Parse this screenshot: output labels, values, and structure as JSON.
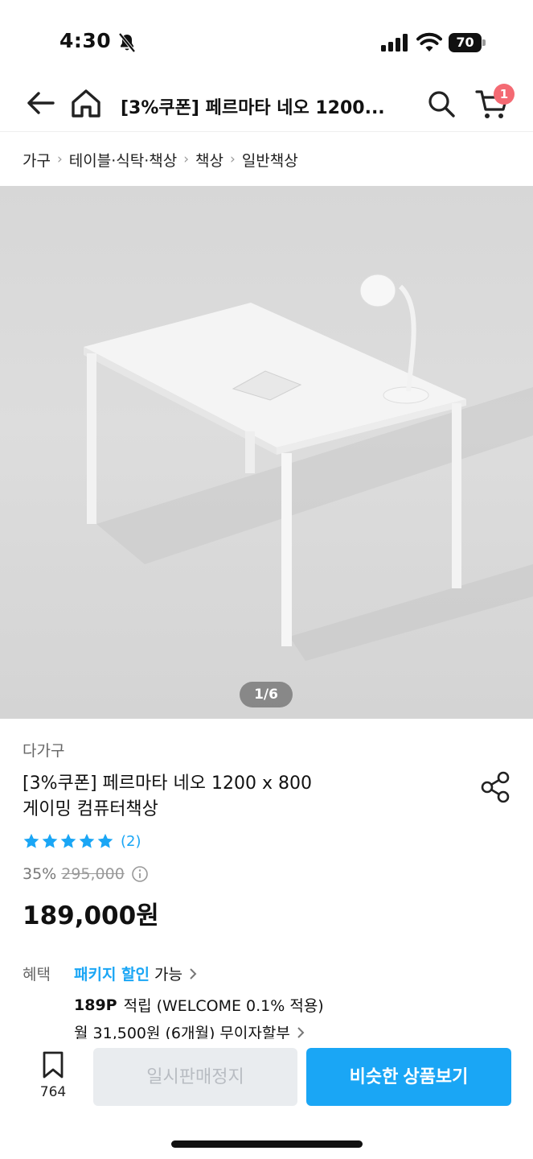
{
  "status_bar": {
    "time": "4:30",
    "battery": "70"
  },
  "nav": {
    "title": "[3%쿠폰] 페르마타 네오 1200...",
    "cart_count": "1"
  },
  "breadcrumb": [
    "가구",
    "테이블·식탁·책상",
    "책상",
    "일반책상"
  ],
  "image": {
    "counter": "1/6"
  },
  "product": {
    "brand": "다가구",
    "name_line1": "[3%쿠폰] 페르마타 네오 1200 x 800",
    "name_line2": "게이밍 컴퓨터책상",
    "rating_stars": 5,
    "review_count": "(2)",
    "discount": "35%",
    "original_price": "295,000",
    "sale_price": "189,000원"
  },
  "benefits": {
    "label": "혜택",
    "package_link": "패키지 할인",
    "package_suffix": "가능",
    "points_bold": "189P",
    "points_text": "적립 (WELCOME 0.1% 적용)",
    "installment": "월 31,500원 (6개월) 무이자할부"
  },
  "bottom_bar": {
    "bookmark_count": "764",
    "disabled_button": "일시판매정지",
    "primary_button": "비슷한 상품보기"
  },
  "colors": {
    "accent": "#1aa6f5",
    "badge": "#f46a73"
  }
}
